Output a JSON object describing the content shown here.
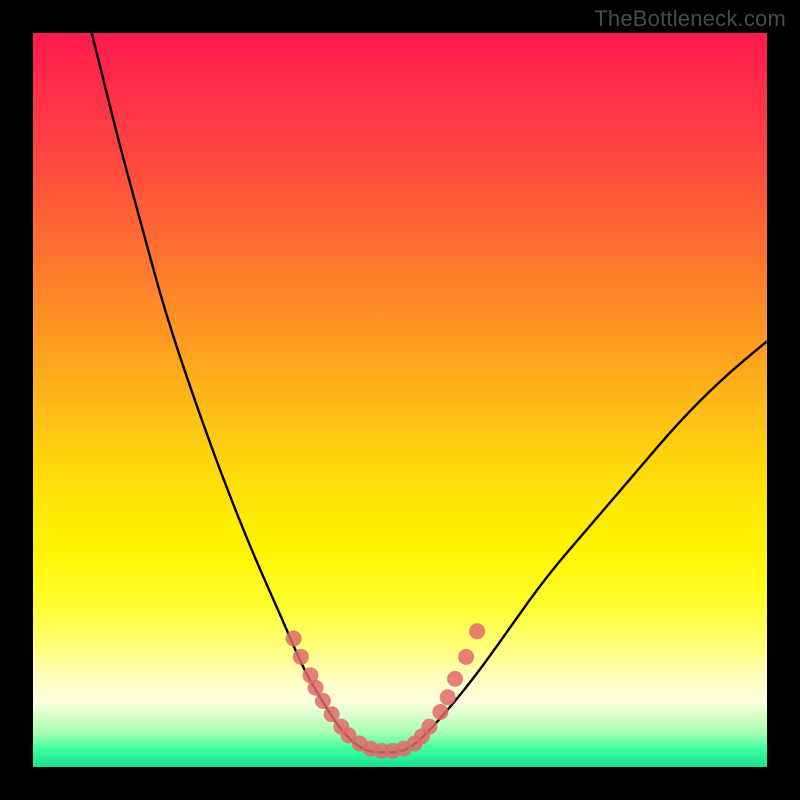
{
  "watermark": "TheBottleneck.com",
  "chart_data": {
    "type": "line",
    "title": "",
    "xlabel": "",
    "ylabel": "",
    "xlim": [
      0,
      100
    ],
    "ylim": [
      0,
      100
    ],
    "grid": false,
    "series": [
      {
        "name": "bottleneck-curve",
        "type": "line",
        "x": [
          8,
          10,
          12,
          15,
          18,
          22,
          26,
          30,
          34,
          37,
          40,
          42,
          44,
          46,
          48,
          50,
          52,
          55,
          60,
          65,
          70,
          76,
          82,
          88,
          94,
          100
        ],
        "y": [
          100,
          92,
          84,
          73,
          62,
          50,
          39,
          29,
          20,
          13,
          8,
          5,
          3,
          2,
          2,
          2,
          3,
          6,
          12,
          19,
          26,
          33,
          40,
          47,
          53,
          58
        ]
      },
      {
        "name": "highlight-dots",
        "type": "scatter",
        "x": [
          35.5,
          36.5,
          37.8,
          38.5,
          39.5,
          40.7,
          42.0,
          43.0,
          44.5,
          46.0,
          47.5,
          49.0,
          50.5,
          52.0,
          53.0,
          54.0,
          55.5,
          56.5,
          57.5,
          59.0,
          60.5
        ],
        "y": [
          17.5,
          15.0,
          12.5,
          10.8,
          9.0,
          7.2,
          5.5,
          4.3,
          3.2,
          2.5,
          2.2,
          2.2,
          2.5,
          3.2,
          4.2,
          5.5,
          7.5,
          9.5,
          12.0,
          15.0,
          18.5
        ]
      }
    ],
    "annotations": [],
    "colors": {
      "curve": "#000000",
      "dots": "#e06a6a",
      "gradient_top": "#ff1a4d",
      "gradient_mid": "#fff400",
      "gradient_bottom": "#18e090",
      "frame": "#000000"
    }
  }
}
